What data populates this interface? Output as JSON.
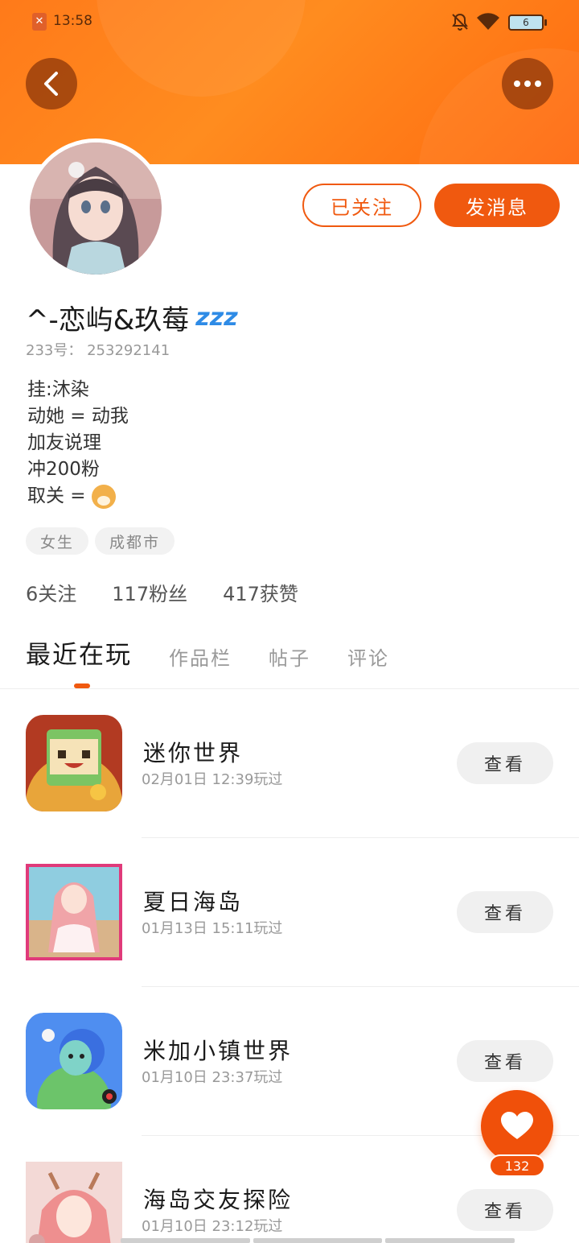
{
  "status_bar": {
    "time": "13:58",
    "battery": "6",
    "icons": [
      "app-notification-icon",
      "bell-muted-icon",
      "wifi-icon",
      "battery-icon"
    ]
  },
  "header": {
    "back_icon": "chevron-left-icon",
    "more_icon": "more-dots-icon",
    "colors": {
      "gradient_start": "#ff7a1a",
      "gradient_end": "#ff6a10"
    }
  },
  "profile": {
    "username": "^-恋屿&玖莓",
    "username_emoji": "zzz",
    "uid_label": "233号：",
    "uid": "253292141",
    "followed_label": "已关注",
    "message_label": "发消息",
    "bio": [
      "挂:沐染",
      "动她 = 动我",
      "加友说理",
      "冲200粉",
      "取关 = "
    ],
    "tags": [
      "女生",
      "成都市"
    ],
    "stats": {
      "following": "6关注",
      "fans": "117粉丝",
      "likes": "417获赞"
    }
  },
  "tabs": [
    "最近在玩",
    "作品栏",
    "帖子",
    "评论"
  ],
  "active_tab": "最近在玩",
  "accent_color": "#f0590f",
  "games": [
    {
      "name": "迷你世界",
      "time": "02月01日 12:39玩过",
      "button": "查看"
    },
    {
      "name": "夏日海岛",
      "time": "01月13日 15:11玩过",
      "button": "查看"
    },
    {
      "name": "米加小镇世界",
      "time": "01月10日 23:37玩过",
      "button": "查看"
    },
    {
      "name": "海岛交友探险",
      "time": "01月10日 23:12玩过",
      "button": "查看"
    }
  ],
  "like_fab": {
    "icon": "heart-icon",
    "count": "132"
  }
}
